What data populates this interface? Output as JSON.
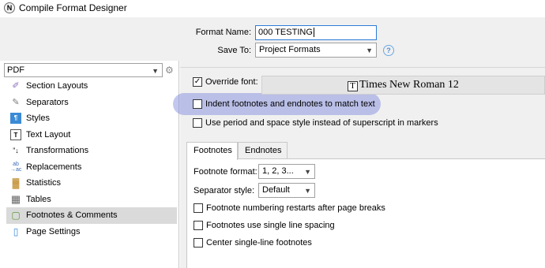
{
  "window": {
    "title": "Compile Format Designer",
    "app_icon": "N"
  },
  "header": {
    "format_name_label": "Format Name:",
    "format_name_value": "000 TESTING",
    "save_to_label": "Save To:",
    "save_to_value": "Project Formats",
    "help_glyph": "?"
  },
  "sidebar": {
    "format_selector": "PDF",
    "items": [
      {
        "label": "Section Layouts",
        "icon": "brush-icon"
      },
      {
        "label": "Separators",
        "icon": "separators-icon"
      },
      {
        "label": "Styles",
        "icon": "styles-icon"
      },
      {
        "label": "Text Layout",
        "icon": "text-layout-icon"
      },
      {
        "label": "Transformations",
        "icon": "transformations-icon"
      },
      {
        "label": "Replacements",
        "icon": "replacements-icon"
      },
      {
        "label": "Statistics",
        "icon": "statistics-icon"
      },
      {
        "label": "Tables",
        "icon": "table-icon"
      },
      {
        "label": "Footnotes & Comments",
        "icon": "footnotes-icon",
        "selected": true
      },
      {
        "label": "Page Settings",
        "icon": "page-icon"
      }
    ]
  },
  "main": {
    "override_font_label": "Override font:",
    "override_font_checked": true,
    "font_display": "Times New Roman 12",
    "font_icon_glyph": "T",
    "indent_footnotes_label": "Indent footnotes and endnotes to match text",
    "period_space_label": "Use period and space style instead of superscript in markers",
    "tabs": [
      {
        "label": "Footnotes",
        "active": true
      },
      {
        "label": "Endnotes",
        "active": false
      }
    ],
    "footnote_format_label": "Footnote format:",
    "footnote_format_value": "1, 2, 3...",
    "separator_style_label": "Separator style:",
    "separator_style_value": "Default",
    "restart_label": "Footnote numbering restarts after page breaks",
    "single_spacing_label": "Footnotes use single line spacing",
    "center_label": "Center single-line footnotes"
  },
  "colors": {
    "highlight": "#7882dc",
    "focus_border": "#2b7bd6",
    "panel_bg": "#f0f0f0"
  }
}
